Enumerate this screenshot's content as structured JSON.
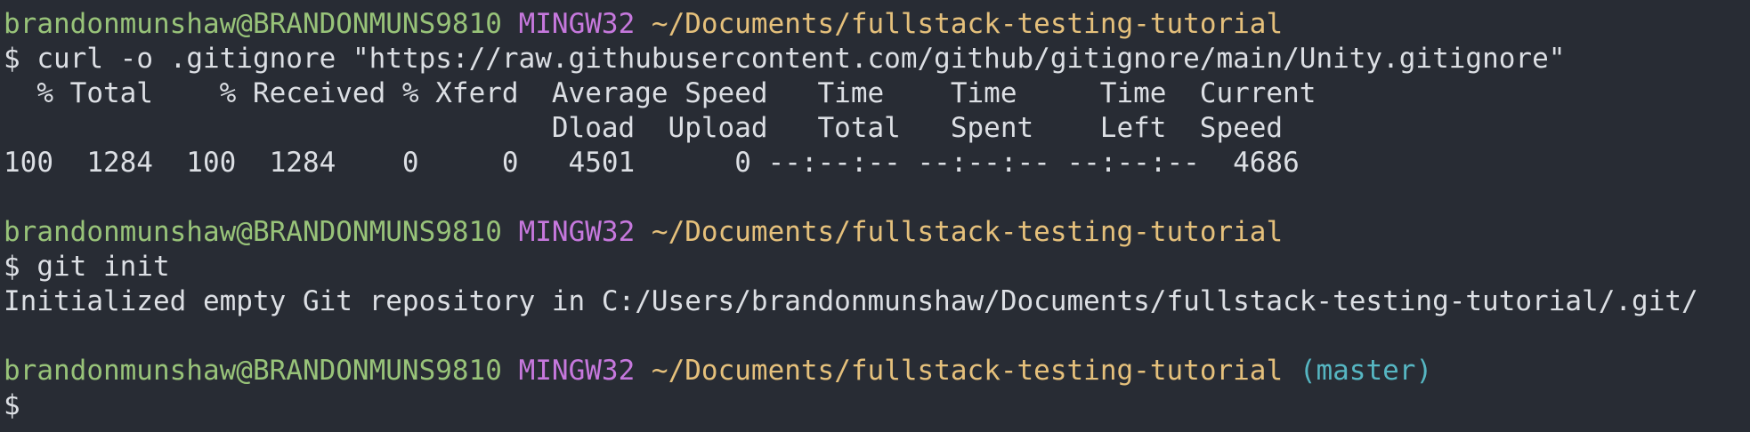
{
  "prompts": [
    {
      "user": "brandonmunshaw@BRANDONMUNS9810",
      "system": "MINGW32",
      "path": "~/Documents/fullstack-testing-tutorial",
      "branch": ""
    },
    {
      "user": "brandonmunshaw@BRANDONMUNS9810",
      "system": "MINGW32",
      "path": "~/Documents/fullstack-testing-tutorial",
      "branch": ""
    },
    {
      "user": "brandonmunshaw@BRANDONMUNS9810",
      "system": "MINGW32",
      "path": "~/Documents/fullstack-testing-tutorial",
      "branch": "(master)"
    }
  ],
  "symbol": "$",
  "commands": [
    "curl -o .gitignore \"https://raw.githubusercontent.com/github/gitignore/main/Unity.gitignore\"",
    "git init",
    ""
  ],
  "curl_output": {
    "header1": "  % Total    % Received % Xferd  Average Speed   Time    Time     Time  Current",
    "header2": "                                 Dload  Upload   Total   Spent    Left  Speed",
    "row": "100  1284  100  1284    0     0   4501      0 --:--:-- --:--:-- --:--:--  4686"
  },
  "git_output": "Initialized empty Git repository in C:/Users/brandonmunshaw/Documents/fullstack-testing-tutorial/.git/"
}
